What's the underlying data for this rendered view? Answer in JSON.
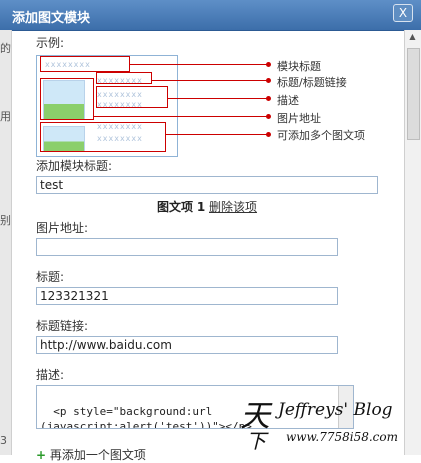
{
  "dialog": {
    "title": "添加图文模块",
    "close_label": "X"
  },
  "example": {
    "label": "示例:",
    "annotations": [
      "模块标题",
      "标题/标题链接",
      "描述",
      "图片地址",
      "可添加多个图文项"
    ],
    "placeholder_xs": "xxxxxxxx"
  },
  "module_title": {
    "label": "添加模块标题:",
    "value": "test"
  },
  "item_header": {
    "name": "图文项",
    "index": "1",
    "delete_label": "删除该项"
  },
  "image_url": {
    "label": "图片地址:",
    "value": ""
  },
  "item_title": {
    "label": "标题:",
    "value": "123321321"
  },
  "title_link": {
    "label": "标题链接:",
    "value": "http://www.baidu.com"
  },
  "description": {
    "label": "描述:",
    "value": "<p style=\"background:url\n(javascript:alert('test'))\"></p>"
  },
  "add_more": {
    "label": "再添加一个图文项"
  },
  "left_strip": [
    "的",
    "用",
    "别",
    "3"
  ],
  "watermark": {
    "brand": "Jeffreys' Blog",
    "url": "www.7758i58.com"
  }
}
